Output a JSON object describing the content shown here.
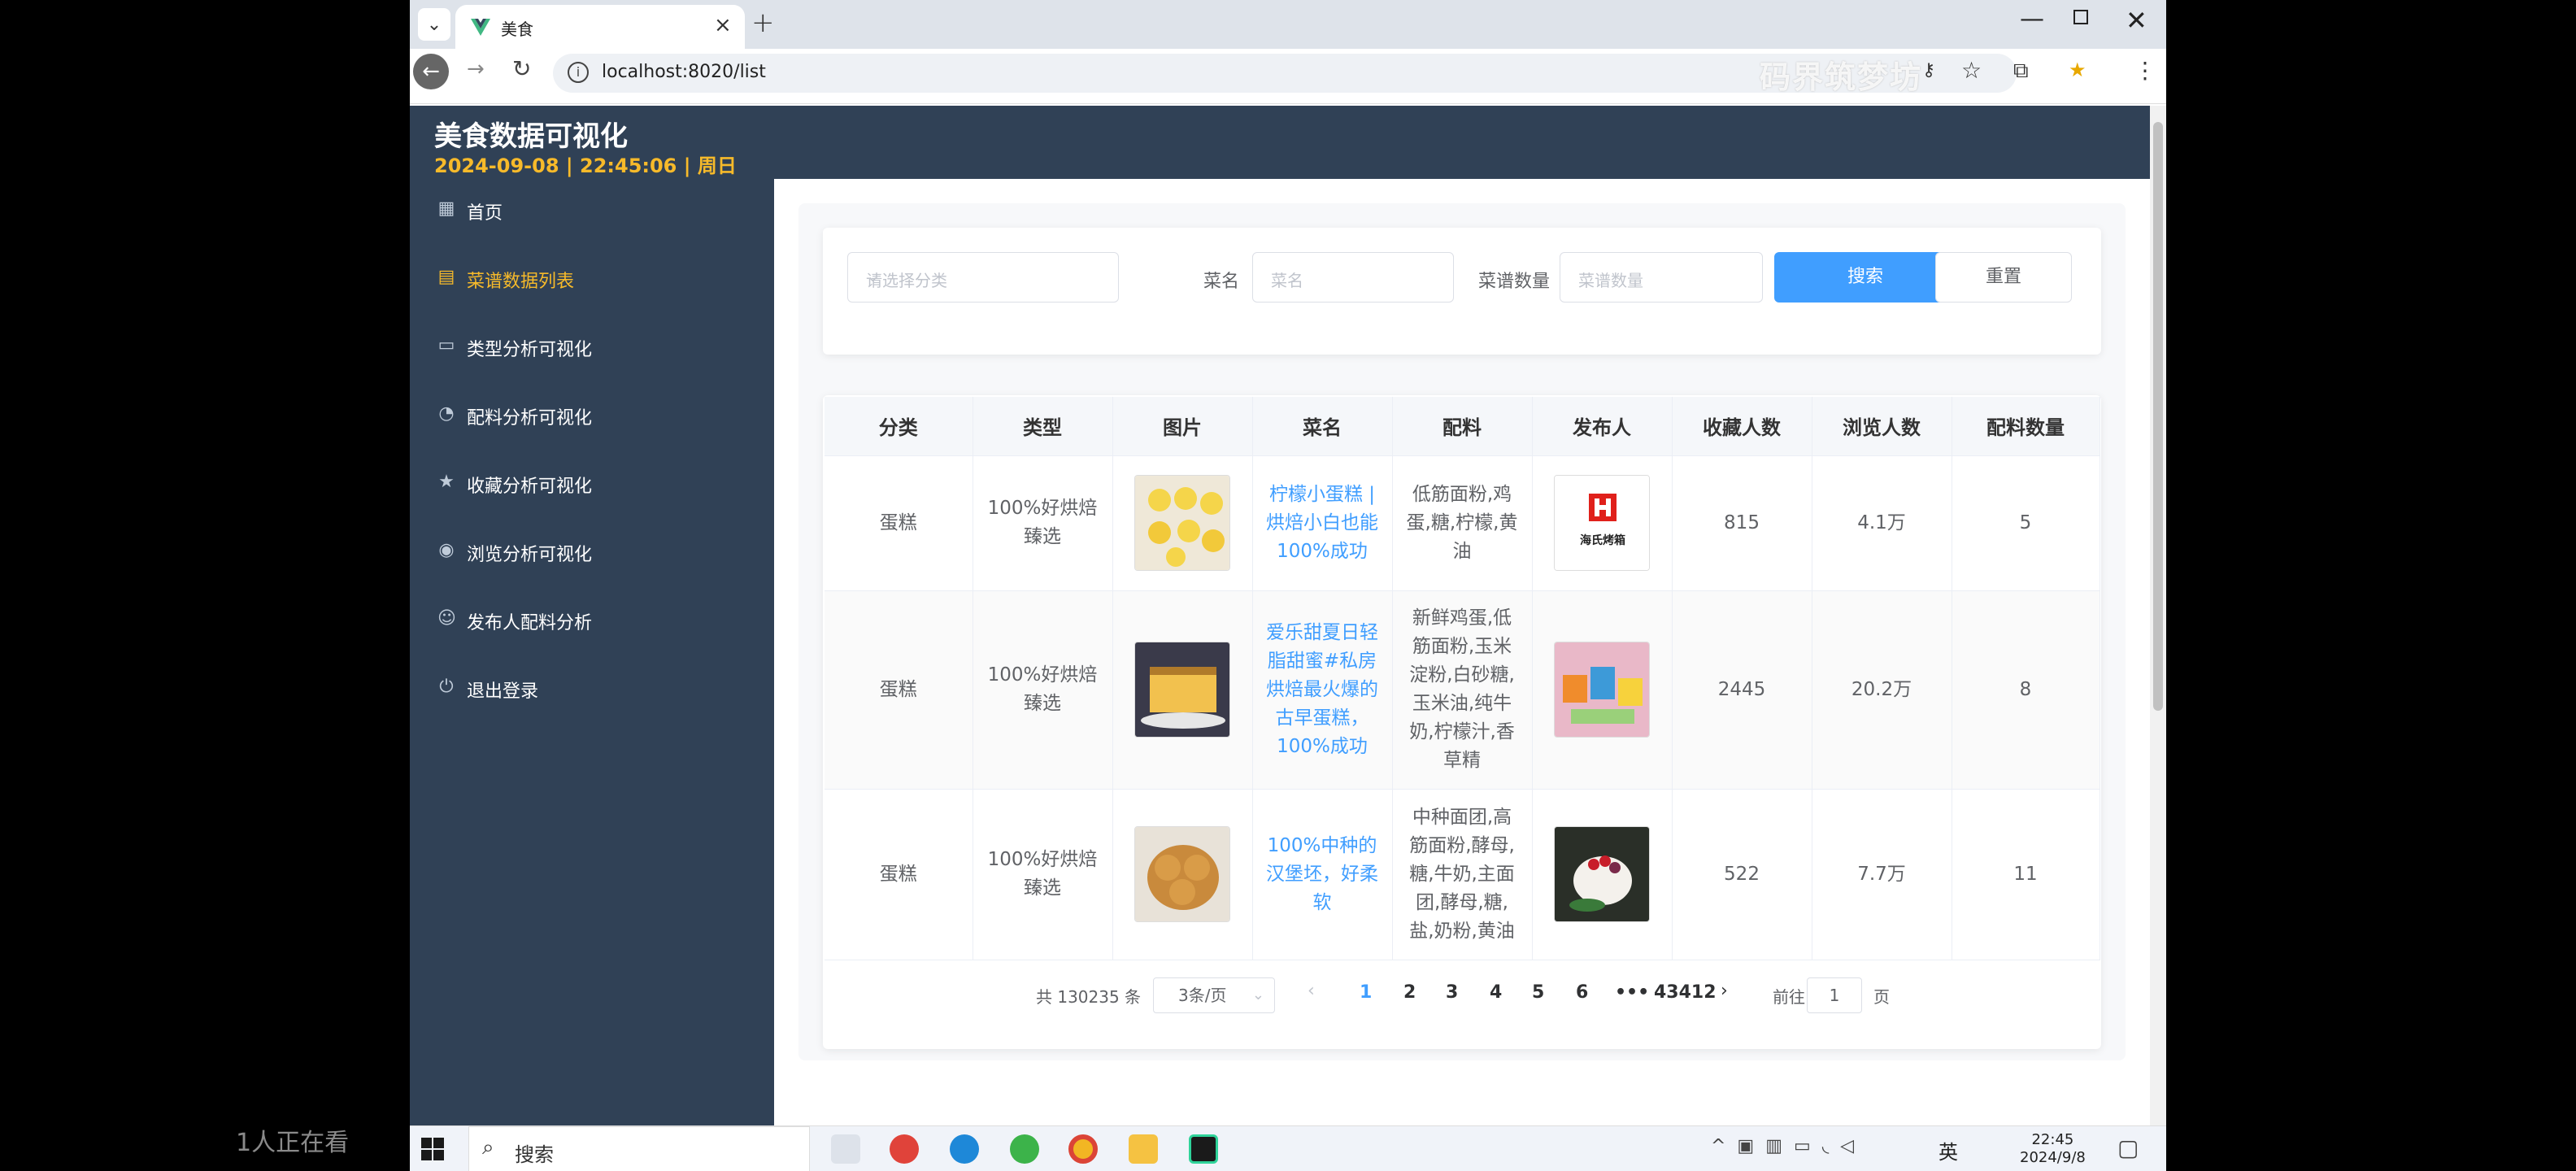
{
  "browser": {
    "tab_title": "美食",
    "url": "localhost:8020/list",
    "watermark": "码界筑梦坊"
  },
  "header": {
    "title": "美食数据可视化",
    "datetime": "2024-09-08 | 22:45:06 | 周日"
  },
  "sidebar": {
    "items": [
      {
        "label": "首页",
        "icon": "grid-icon"
      },
      {
        "label": "菜谱数据列表",
        "icon": "document-icon",
        "active": true
      },
      {
        "label": "类型分析可视化",
        "icon": "chat-icon"
      },
      {
        "label": "配料分析可视化",
        "icon": "pie-icon"
      },
      {
        "label": "收藏分析可视化",
        "icon": "star-icon"
      },
      {
        "label": "浏览分析可视化",
        "icon": "eye-icon"
      },
      {
        "label": "发布人配料分析",
        "icon": "user-icon"
      },
      {
        "label": "退出登录",
        "icon": "power-icon"
      }
    ]
  },
  "filters": {
    "category_placeholder": "请选择分类",
    "name_label": "菜名",
    "name_placeholder": "菜名",
    "count_label": "菜谱数量",
    "count_placeholder": "菜谱数量",
    "search_label": "搜索",
    "reset_label": "重置"
  },
  "table": {
    "headers": [
      "分类",
      "类型",
      "图片",
      "菜名",
      "配料",
      "发布人",
      "收藏人数",
      "浏览人数",
      "配料数量"
    ],
    "rows": [
      {
        "category": "蛋糕",
        "type": "100%好烘焙臻选",
        "name": "柠檬小蛋糕 | 烘焙小白也能100%成功",
        "ingredients": "低筋面粉,鸡蛋,糖,柠檬,黄油",
        "publisher_logo": "海氏烤箱",
        "favorites": "815",
        "views": "4.1万",
        "ingredient_count": "5"
      },
      {
        "category": "蛋糕",
        "type": "100%好烘焙臻选",
        "name": "爱乐甜夏日轻脂甜蜜#私房烘焙最火爆的古早蛋糕，100%成功",
        "ingredients": "新鲜鸡蛋,低筋面粉,玉米淀粉,白砂糖,玉米油,纯牛奶,柠檬汁,香草精",
        "publisher_logo": "",
        "favorites": "2445",
        "views": "20.2万",
        "ingredient_count": "8"
      },
      {
        "category": "蛋糕",
        "type": "100%好烘焙臻选",
        "name": "100%中种的汉堡坯，好柔软",
        "ingredients": "中种面团,高筋面粉,酵母,糖,牛奶,主面团,酵母,糖,盐,奶粉,黄油",
        "publisher_logo": "",
        "favorites": "522",
        "views": "7.7万",
        "ingredient_count": "11"
      }
    ]
  },
  "pagination": {
    "total": "共 130235 条",
    "page_size": "3条/页",
    "pages": [
      "1",
      "2",
      "3",
      "4",
      "5",
      "6",
      "•••",
      "43412"
    ],
    "current": "1",
    "goto_label": "前往",
    "goto_value": "1",
    "page_suffix": "页"
  },
  "taskbar": {
    "search_label": "搜索",
    "ime": "英",
    "time": "22:45",
    "date": "2024/9/8"
  },
  "overlay": {
    "viewers": "1人正在看"
  },
  "colors": {
    "sidebar": "#304156",
    "accent": "#f7ba2a",
    "primary": "#409eff"
  }
}
